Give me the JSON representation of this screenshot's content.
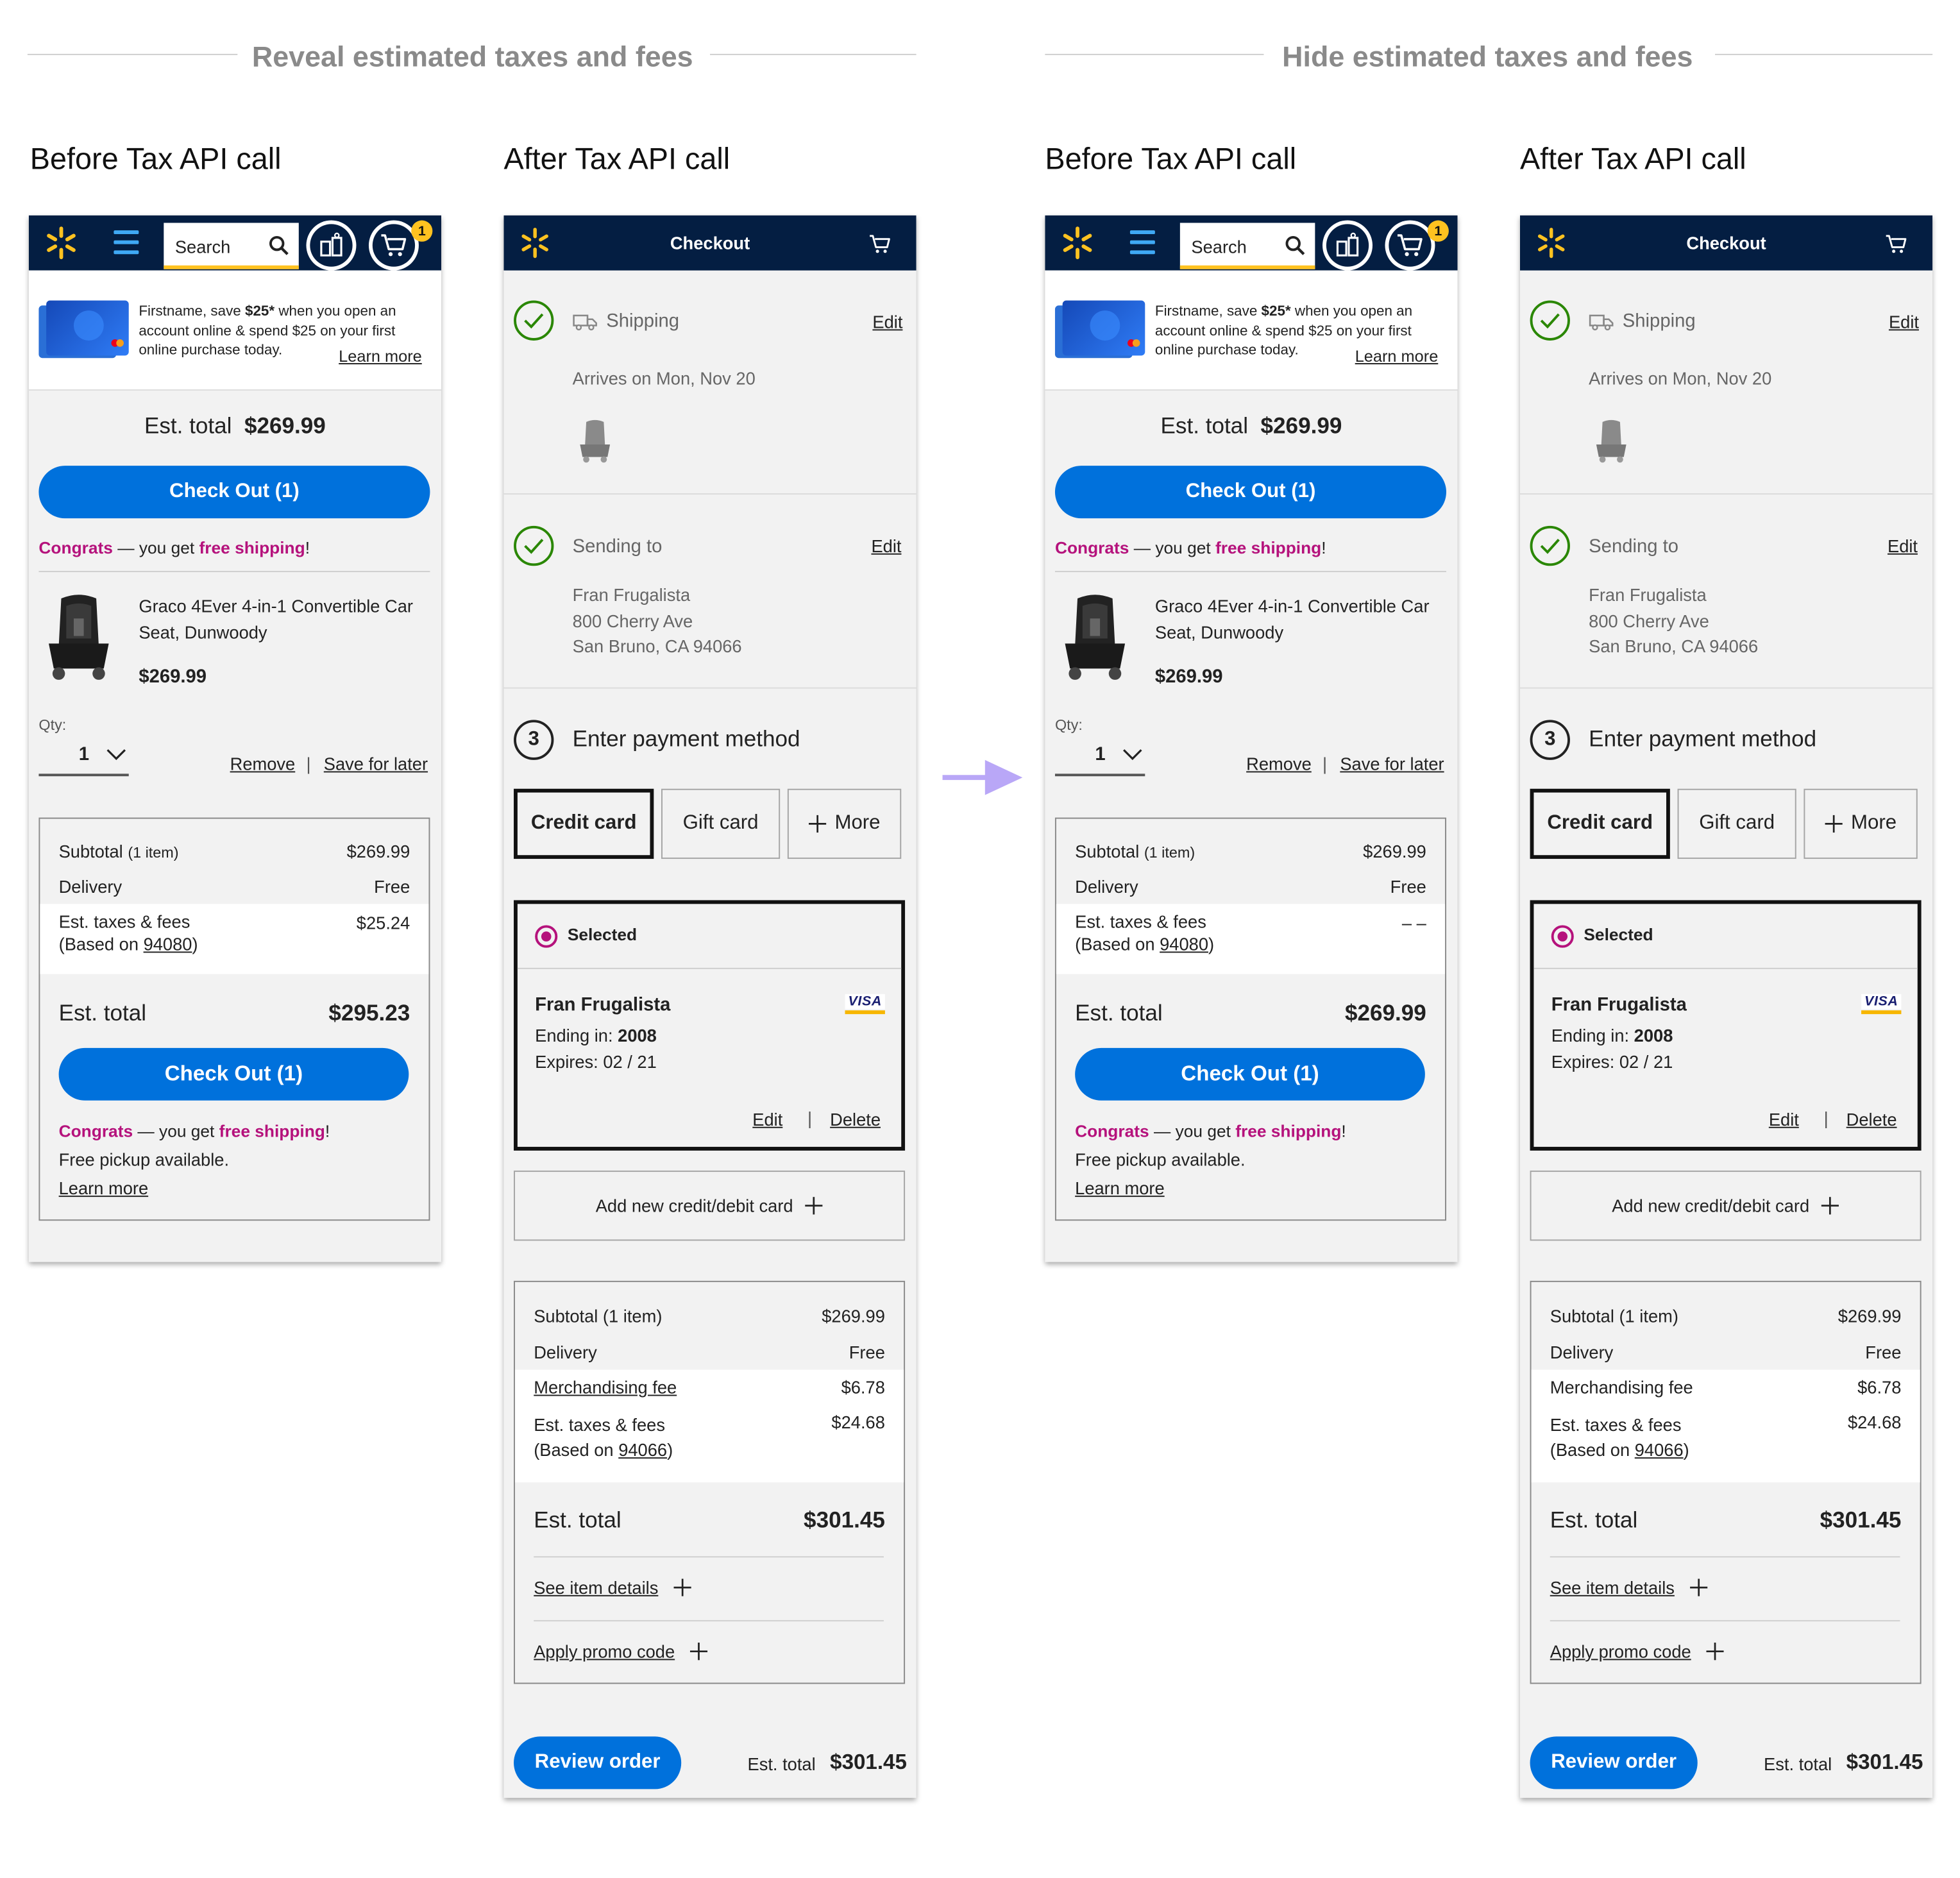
{
  "sections": {
    "reveal": "Reveal estimated taxes and fees",
    "hide": "Hide estimated taxes and fees"
  },
  "labels": {
    "before": "Before Tax API call",
    "after": "After Tax API call"
  },
  "cart": {
    "search_placeholder": "Search",
    "cart_count": "1",
    "promo_text_1": "Firstname, save ",
    "promo_bold": "$25*",
    "promo_text_2": " when you open an account online & spend $25 on your first online purchase today.",
    "promo_link": "Learn more",
    "est_total_label": "Est. total",
    "est_total_value": "$269.99",
    "checkout_btn": "Check Out (1)",
    "congrats": "Congrats",
    "dash": " — you get ",
    "free_shipping": "free shipping",
    "exclaim": "!",
    "item_name": "Graco 4Ever 4-in-1 Convertible Car Seat, Dunwoody",
    "item_price": "$269.99",
    "qty_label": "Qty:",
    "qty_value": "1",
    "remove": "Remove",
    "sep": "|",
    "save_later": "Save for later",
    "subtotal_label": "Subtotal",
    "subtotal_items": "(1 item)",
    "subtotal_value": "$269.99",
    "delivery_label": "Delivery",
    "delivery_value": "Free",
    "taxes_label": "Est. taxes & fees",
    "based_on_pre": "(Based on ",
    "zip": "94080",
    "based_on_post": ")",
    "taxes_value_reveal": "$25.24",
    "taxes_value_hide": "– –",
    "est_total_reveal": "$295.23",
    "est_total_hide": "$269.99",
    "free_pickup": "Free pickup available.",
    "learn_more": "Learn more"
  },
  "checkout": {
    "title": "Checkout",
    "shipping": "Shipping",
    "edit": "Edit",
    "arrives": "Arrives on Mon, Nov 20",
    "sending_to": "Sending to",
    "name": "Fran Frugalista",
    "address1": "800 Cherry Ave",
    "address2": "San Bruno, CA 94066",
    "step_num": "3",
    "step_title": "Enter payment method",
    "tab_credit": "Credit card",
    "tab_gift": "Gift card",
    "tab_more": "More",
    "selected": "Selected",
    "card_name": "Fran Frugalista",
    "ending_label": "Ending in: ",
    "ending_value": "2008",
    "expires": "Expires: 02 / 21",
    "card_brand": "VISA",
    "card_edit": "Edit",
    "card_delete": "Delete",
    "add_card": "Add new credit/debit card",
    "subtotal": "Subtotal (1 item)",
    "subtotal_value": "$269.99",
    "delivery": "Delivery",
    "delivery_value": "Free",
    "merch_fee": "Merchandising fee",
    "merch_value": "$6.78",
    "taxes": "Est. taxes & fees",
    "based_on_pre": "(Based on ",
    "zip": "94066",
    "based_on_post": ")",
    "taxes_value": "$24.68",
    "est_total_label": "Est. total",
    "est_total_value": "$301.45",
    "see_details": "See item details",
    "apply_promo": "Apply promo code",
    "review_btn": "Review order",
    "footer_est_label": "Est. total",
    "footer_est_value": "$301.45"
  },
  "colors": {
    "navy": "#041e42",
    "blue": "#0071dc",
    "yellow": "#ffc220",
    "pink": "#b5127c",
    "green": "#2a8703",
    "arrow": "#b9a7f7"
  }
}
